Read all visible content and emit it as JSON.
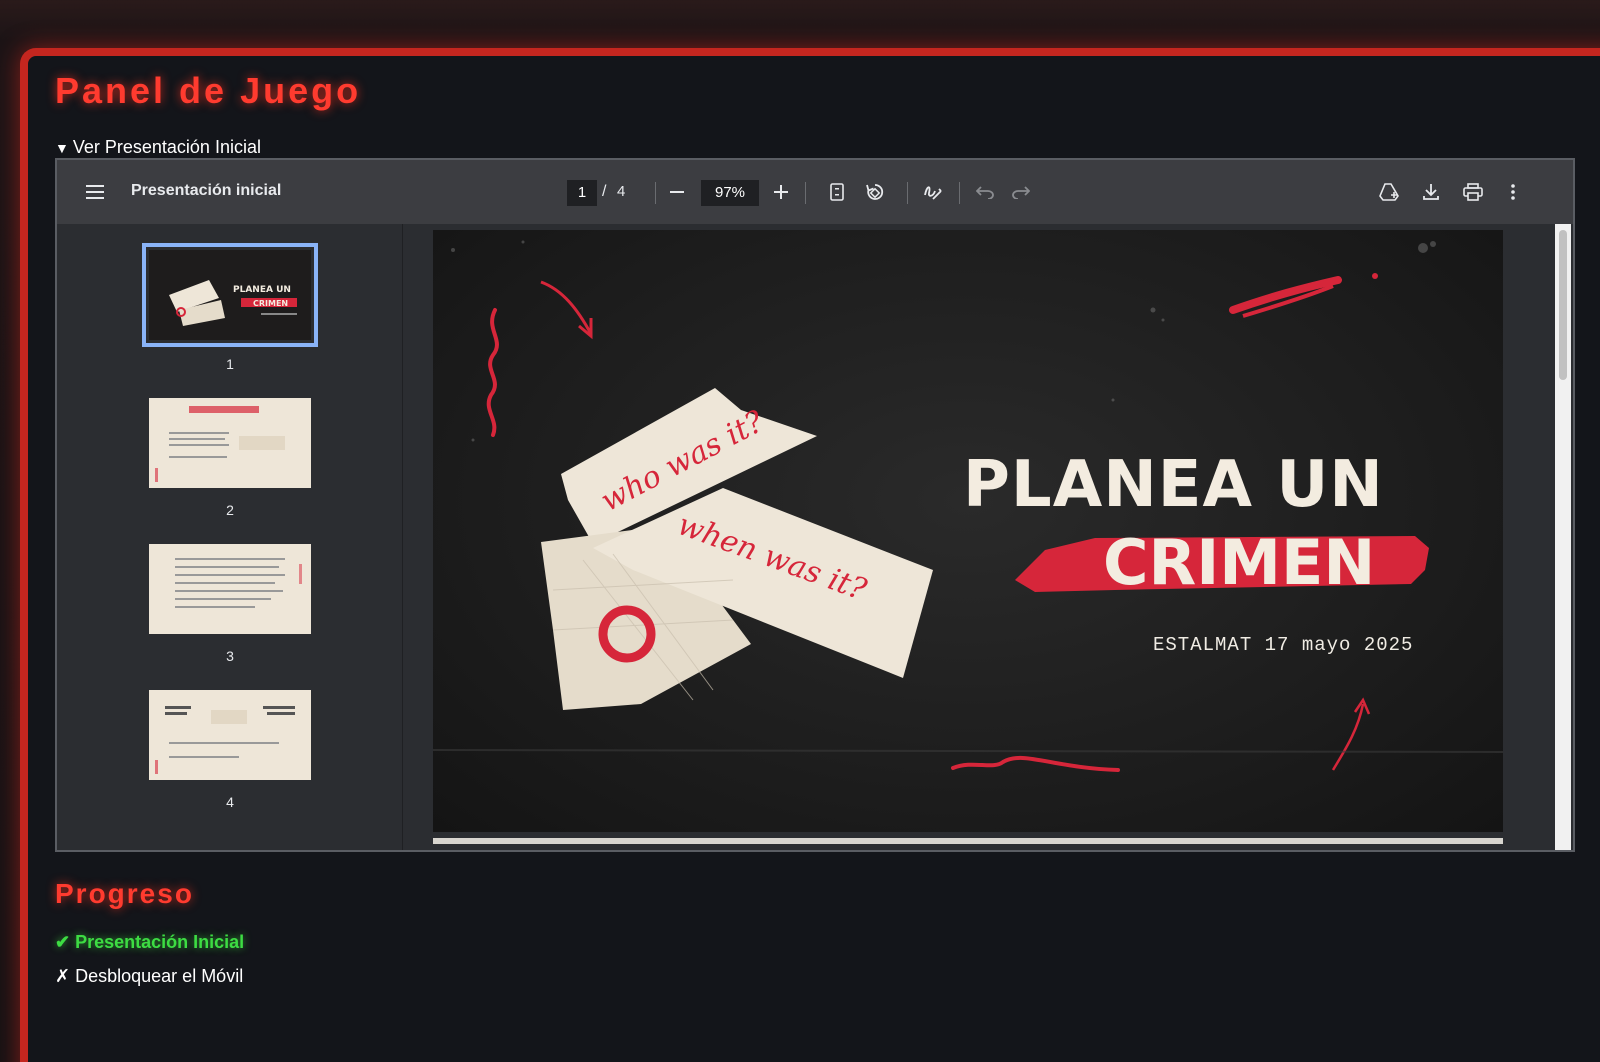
{
  "page": {
    "title": "Panel de Juego",
    "details_summary": "Ver Presentación Inicial"
  },
  "viewer": {
    "doc_title": "Presentación inicial",
    "current_page": "1",
    "page_separator": "/",
    "total_pages": "4",
    "zoom": "97%",
    "icons": {
      "menu": "menu-icon",
      "zoom_out": "minus-icon",
      "zoom_in": "plus-icon",
      "fit": "fit-page-icon",
      "rotate": "rotate-icon",
      "annotate": "draw-icon",
      "undo": "undo-icon",
      "redo": "redo-icon",
      "drive": "add-to-drive-icon",
      "download": "download-icon",
      "print": "print-icon",
      "more": "more-vert-icon"
    },
    "thumbnails": [
      {
        "num": "1",
        "selected": true
      },
      {
        "num": "2",
        "selected": false
      },
      {
        "num": "3",
        "selected": false
      },
      {
        "num": "4",
        "selected": false
      }
    ],
    "slide": {
      "title_line1": "PLANEA UN",
      "title_line2": "CRIMEN",
      "subtitle": "ESTALMAT 17 mayo 2025",
      "note1": "who was it?",
      "note2": "when was it?"
    }
  },
  "progress": {
    "title": "Progreso",
    "items": [
      {
        "mark": "✔",
        "label": "Presentación Inicial",
        "done": true
      },
      {
        "mark": "✗",
        "label": "Desbloquear el Móvil",
        "done": false
      }
    ]
  },
  "colors": {
    "accent": "#ff3b2f",
    "frame": "#c4261f",
    "done": "#3ddc43",
    "slide_red": "#d6263a",
    "paper": "#eee6d8"
  }
}
